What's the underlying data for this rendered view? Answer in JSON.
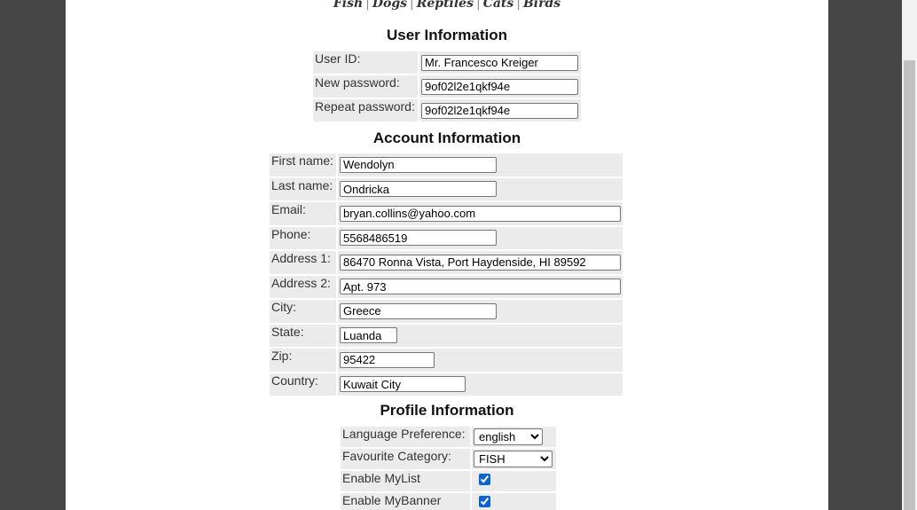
{
  "nav": {
    "categories": [
      "Fish",
      "Dogs",
      "Reptiles",
      "Cats",
      "Birds"
    ]
  },
  "user_info": {
    "title": "User Information",
    "user_id_label": "User ID:",
    "user_id_value": "Mr. Francesco Kreiger",
    "new_password_label": "New password:",
    "new_password_value": "9of02l2e1qkf94e",
    "repeat_password_label": "Repeat password:",
    "repeat_password_value": "9of02l2e1qkf94e"
  },
  "account_info": {
    "title": "Account Information",
    "first_name_label": "First name:",
    "first_name_value": "Wendolyn",
    "last_name_label": "Last name:",
    "last_name_value": "Ondricka",
    "email_label": "Email:",
    "email_value": "bryan.collins@yahoo.com",
    "phone_label": "Phone:",
    "phone_value": "5568486519",
    "address1_label": "Address 1:",
    "address1_value": "86470 Ronna Vista, Port Haydenside, HI 89592",
    "address2_label": "Address 2:",
    "address2_value": "Apt. 973",
    "city_label": "City:",
    "city_value": "Greece",
    "state_label": "State:",
    "state_value": "Luanda",
    "zip_label": "Zip:",
    "zip_value": "95422",
    "country_label": "Country:",
    "country_value": "Kuwait City"
  },
  "profile_info": {
    "title": "Profile Information",
    "language_label": "Language Preference:",
    "language_value": "english",
    "category_label": "Favourite Category:",
    "category_value": "FISH",
    "mylist_label": "Enable MyList",
    "mylist_checked": true,
    "mybanner_label": "Enable MyBanner",
    "mybanner_checked": true
  },
  "colors": {
    "page_background": "#ffffff",
    "outer_background": "#464646",
    "cell_background": "#ebebeb",
    "checkbox_accent": "#0b63d1"
  }
}
